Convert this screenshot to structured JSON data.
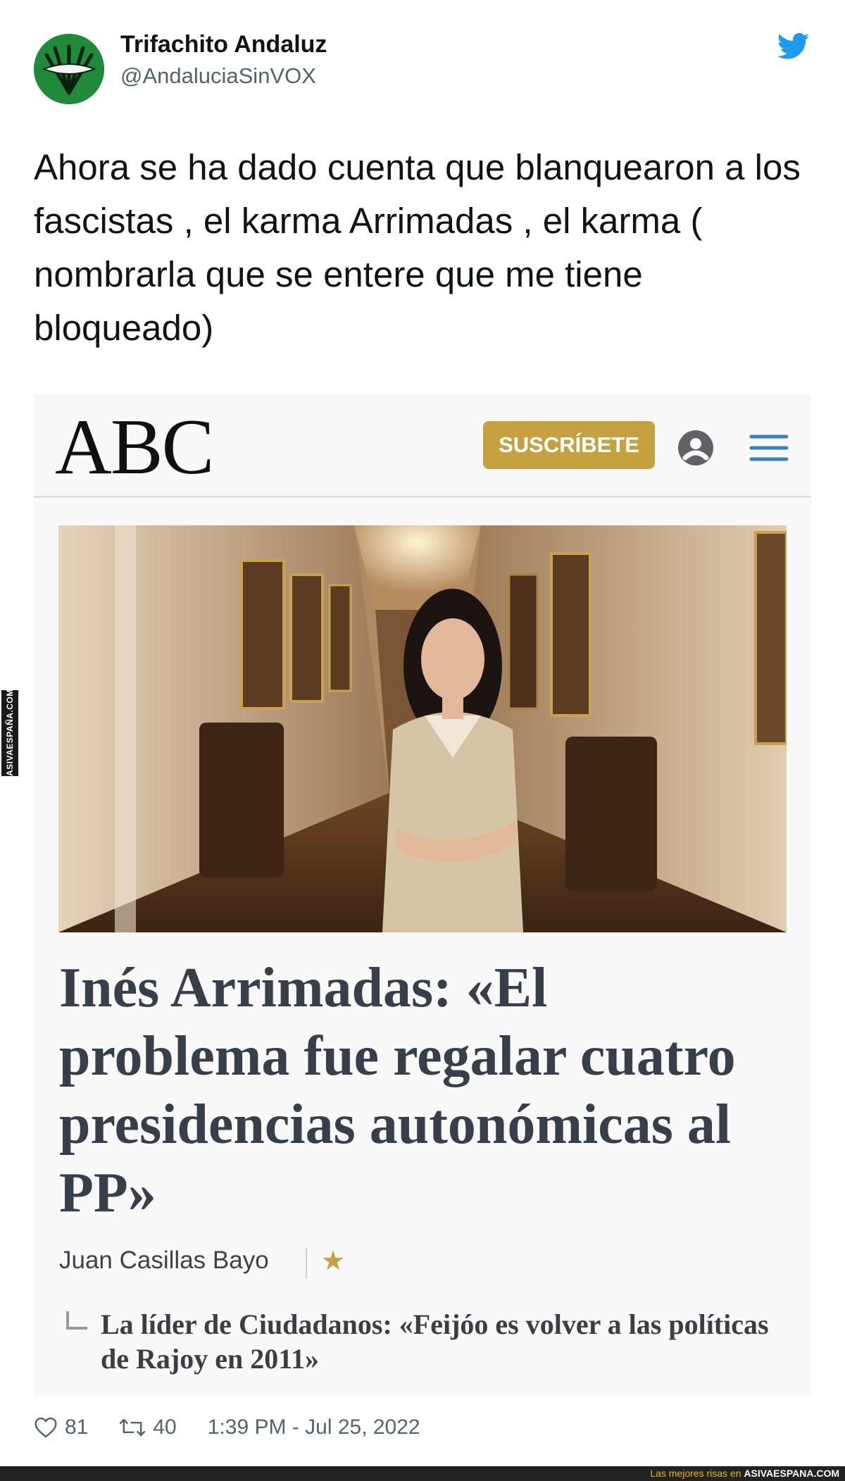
{
  "tweet": {
    "author_name": "Trifachito Andaluz",
    "author_handle": "@AndaluciaSinVOX",
    "text": "Ahora se ha dado cuenta que blanquearon a los fascistas , el karma Arrimadas , el karma ( nombrarla que se entere que me tiene bloqueado)",
    "likes": "81",
    "retweets": "40",
    "timestamp": "1:39 PM - Jul 25, 2022"
  },
  "article": {
    "site_logo": "ABC",
    "subscribe_label": "SUSCRÍBETE",
    "headline": "Inés Arrimadas: «El problema fue regalar cuatro presidencias autonómicas al PP»",
    "author": "Juan Casillas Bayo",
    "author_badge": "★",
    "related_link": "La líder de Ciudadanos: «Feijóo es volver a las políticas de Rajoy en 2011»"
  },
  "watermark": {
    "side_text": "ASIVAESPAÑA.COM",
    "footer_prefix": "Las mejores risas en",
    "footer_site": "ASIVAESPANA.COM"
  },
  "colors": {
    "twitter_blue": "#1d9bf0",
    "subscribe_gold": "#c6a13f",
    "headline_slate": "#37404a",
    "avatar_green": "#1f8a3a",
    "footer_yellow": "#e8b800"
  },
  "icons": [
    "twitter-bird-icon",
    "user-icon",
    "hamburger-menu-icon",
    "heart-icon",
    "retweet-icon",
    "star-icon"
  ]
}
